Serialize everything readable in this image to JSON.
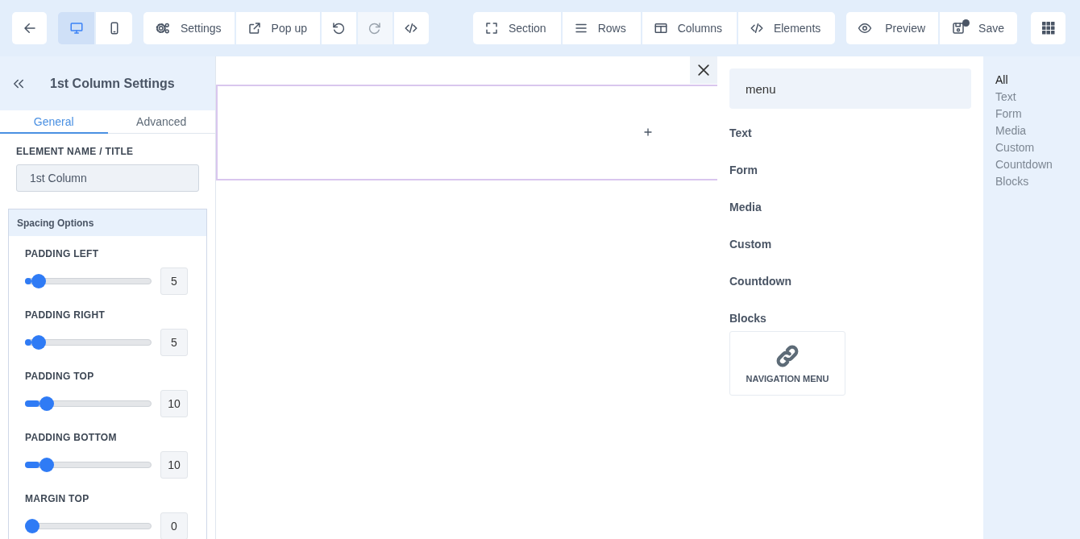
{
  "toolbar": {
    "devices": [
      {
        "selected": true
      },
      {
        "selected": false
      }
    ],
    "tools": [
      {
        "kind": "text",
        "label": "Settings",
        "disabled": false
      },
      {
        "kind": "text",
        "label": "Pop up",
        "disabled": false
      },
      {
        "kind": "icon",
        "disabled": false
      },
      {
        "kind": "icon",
        "disabled": true
      },
      {
        "kind": "icon",
        "disabled": false
      }
    ],
    "structure": [
      {
        "label": "Section"
      },
      {
        "label": "Rows"
      },
      {
        "label": "Columns"
      },
      {
        "label": "Elements"
      }
    ],
    "preview": {
      "label": "Preview"
    },
    "save": {
      "label": "Save",
      "unsaved": true
    }
  },
  "settings_panel": {
    "title": "1st Column Settings",
    "tabs": [
      {
        "label": "General",
        "selected": true
      },
      {
        "label": "Advanced",
        "selected": false
      }
    ],
    "name_field": {
      "label": "ELEMENT NAME / TITLE",
      "value": "1st Column"
    },
    "spacing": {
      "title": "Spacing Options",
      "sliders": [
        {
          "label": "PADDING LEFT",
          "level": 0.06,
          "value": "5"
        },
        {
          "label": "PADDING RIGHT",
          "level": 0.06,
          "value": "5"
        },
        {
          "label": "PADDING TOP",
          "level": 0.13,
          "value": "10"
        },
        {
          "label": "PADDING BOTTOM",
          "level": 0.13,
          "value": "10"
        },
        {
          "label": "MARGIN TOP",
          "level": 0,
          "value": "0"
        }
      ]
    }
  },
  "elements_panel": {
    "search": {
      "value": "menu"
    },
    "categories": [
      {
        "title": "Text"
      },
      {
        "title": "Form"
      },
      {
        "title": "Media"
      },
      {
        "title": "Custom"
      },
      {
        "title": "Countdown"
      },
      {
        "title": "Blocks",
        "items": [
          {
            "label": "NAVIGATION MENU"
          }
        ]
      }
    ],
    "filters": [
      {
        "label": "All",
        "selected": true
      },
      {
        "label": "Text",
        "selected": false
      },
      {
        "label": "Form",
        "selected": false
      },
      {
        "label": "Media",
        "selected": false
      },
      {
        "label": "Custom",
        "selected": false
      },
      {
        "label": "Countdown",
        "selected": false
      },
      {
        "label": "Blocks",
        "selected": false
      }
    ]
  }
}
